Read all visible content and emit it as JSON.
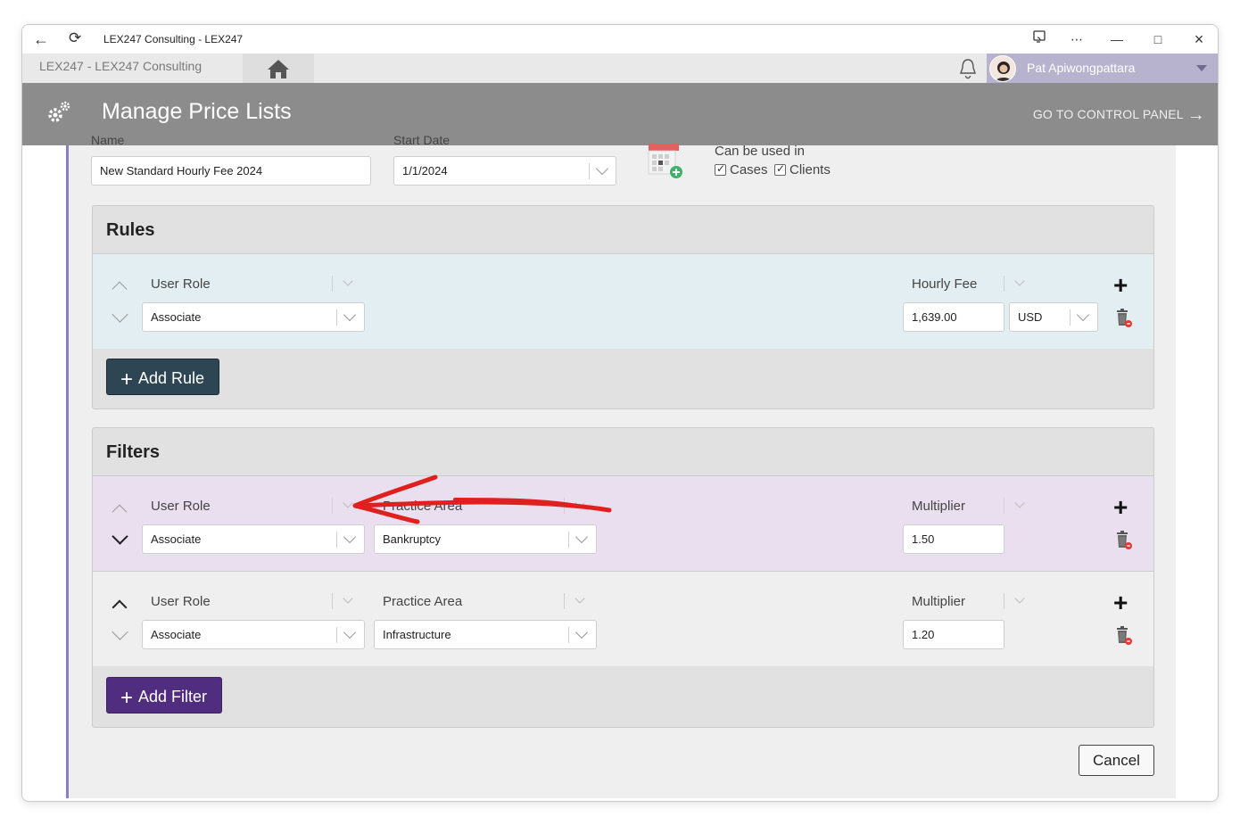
{
  "window": {
    "title": "LEX247 Consulting - LEX247",
    "breadcrumb": "LEX247   -  LEX247 Consulting",
    "user_name": "Pat Apiwongpattara"
  },
  "header": {
    "title": "Manage Price Lists",
    "control_panel_link": "GO TO CONTROL PANEL"
  },
  "form": {
    "name_label": "Name",
    "name_value": "New Standard Hourly Fee 2024",
    "start_date_label": "Start Date",
    "start_date_value": "1/1/2024",
    "usage_label": "Can be used in",
    "usage_options": [
      {
        "label": "Cases",
        "checked": true
      },
      {
        "label": "Clients",
        "checked": true
      }
    ]
  },
  "rules": {
    "title": "Rules",
    "rows": [
      {
        "col1_header": "User Role",
        "col1_value": "Associate",
        "col3_header": "Hourly Fee",
        "col3_value": "1,639.00",
        "currency": "USD"
      }
    ],
    "add_button": "Add Rule",
    "add_button_color": "#2e4654"
  },
  "filters": {
    "title": "Filters",
    "rows": [
      {
        "col1_header": "User Role",
        "col1_value": "Associate",
        "col2_header": "Practice Area",
        "col2_value": "Bankruptcy",
        "col3_header": "Multiplier",
        "col3_value": "1.50",
        "highlight": "#eadfee"
      },
      {
        "col1_header": "User Role",
        "col1_value": "Associate",
        "col2_header": "Practice Area",
        "col2_value": "Infrastructure",
        "col3_header": "Multiplier",
        "col3_value": "1.20"
      }
    ],
    "add_button": "Add Filter",
    "add_button_color": "#512d7f"
  },
  "footer": {
    "cancel_label": "Cancel"
  },
  "colors": {
    "header_bg": "#8c8c8c",
    "rules_row_bg": "#e3eef2",
    "content_accent": "#8780c5",
    "annotation_arrow": "#e0201f"
  },
  "icons": [
    "back-arrow-icon",
    "refresh-icon",
    "cast-icon",
    "more-icon",
    "minimize-icon",
    "maximize-icon",
    "close-icon",
    "home-icon",
    "bell-icon",
    "gear-icon",
    "calendar-add-icon",
    "plus-icon",
    "trash-icon",
    "chevron-up-icon",
    "chevron-down-icon"
  ]
}
